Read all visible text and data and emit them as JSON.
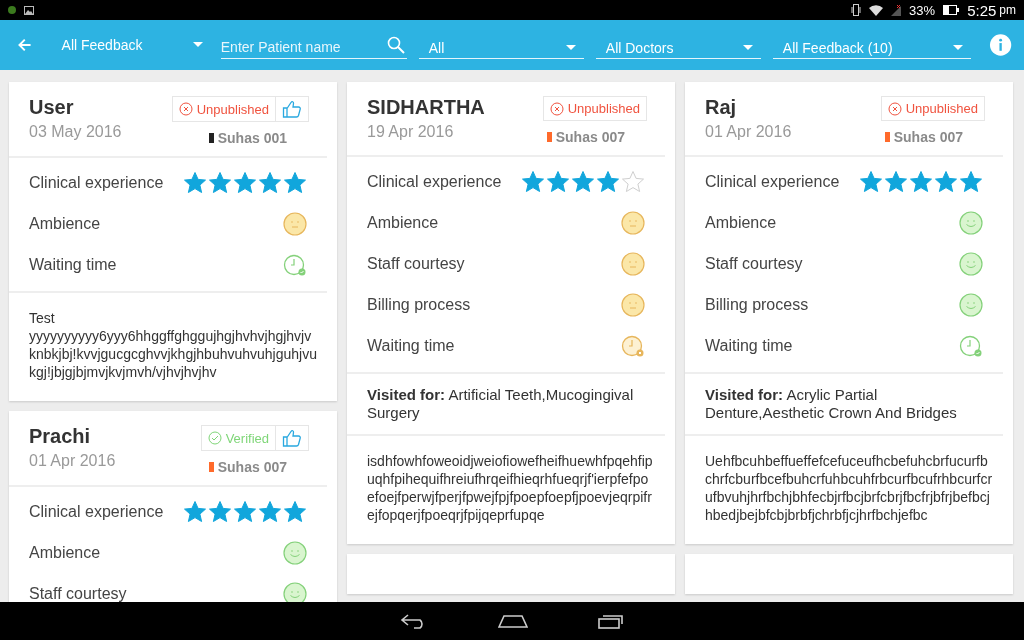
{
  "status_bar": {
    "battery": "33%",
    "time": "5:25",
    "ampm": "pm"
  },
  "app_bar": {
    "feedback_menu": "All Feedback",
    "search": {
      "placeholder": "Enter Patient name"
    },
    "filters": [
      {
        "label": "All"
      },
      {
        "label": "All Doctors"
      },
      {
        "label": "All Feedback (10)"
      }
    ]
  },
  "columns": [
    {
      "cards": [
        {
          "name": "User",
          "date": "03 May 2016",
          "status": {
            "kind": "unpublished",
            "label": "Unpublished"
          },
          "thumbs": true,
          "doctor": {
            "name": "Suhas 001",
            "color": "#222222"
          },
          "ratings": [
            {
              "label": "Clinical experience",
              "kind": "stars",
              "stars": 5
            },
            {
              "label": "Ambience",
              "kind": "face",
              "happy": false
            },
            {
              "label": "Waiting time",
              "kind": "clock",
              "happy": true
            }
          ],
          "comment": "Test yyyyyyyyyy6yyy6hhggffghggujhgjhvhvjhgjhvjvknbkjbj!kvvjgucgcghvvjkhgjhbuhvuhvuhjguhjvukgj!jbjgjbjmvjkvjmvh/vjhvjhvjhv"
        },
        {
          "name": "Prachi",
          "date": "01 Apr 2016",
          "status": {
            "kind": "verified",
            "label": "Verified"
          },
          "thumbs": true,
          "doctor": {
            "name": "Suhas 007",
            "color": "#ff6a2b"
          },
          "ratings": [
            {
              "label": "Clinical experience",
              "kind": "stars",
              "stars": 5
            },
            {
              "label": "Ambience",
              "kind": "face",
              "happy": true
            },
            {
              "label": "Staff courtesy",
              "kind": "face",
              "happy": true
            }
          ]
        }
      ]
    },
    {
      "cards": [
        {
          "name": "SIDHARTHA",
          "date": "19 Apr 2016",
          "status": {
            "kind": "unpublished",
            "label": "Unpublished"
          },
          "thumbs": false,
          "doctor": {
            "name": "Suhas 007",
            "color": "#ff6a2b"
          },
          "ratings": [
            {
              "label": "Clinical experience",
              "kind": "stars",
              "stars": 4
            },
            {
              "label": "Ambience",
              "kind": "face",
              "happy": false
            },
            {
              "label": "Staff courtesy",
              "kind": "face",
              "happy": false
            },
            {
              "label": "Billing process",
              "kind": "face",
              "happy": false
            },
            {
              "label": "Waiting time",
              "kind": "clock",
              "happy": false
            }
          ],
          "visited_for": "**Visited for:** Artificial Teeth,Mucogingival Surgery",
          "comment": "isdhfowhfoweoidjweiofiowefheifhuewhfpqehfipuqhfpihequifhreiufhrqeifhieqrhfueqrjf'ierpfefpoefoejfperwjfperjfpwejfpjfpoepfoepfjpoevjeqrpifrejfopqerjfpoeqrjfpijqeprfupqe"
        },
        {
          "kind": "cut"
        }
      ]
    },
    {
      "cards": [
        {
          "name": "Raj",
          "date": "01 Apr 2016",
          "status": {
            "kind": "unpublished",
            "label": "Unpublished"
          },
          "thumbs": false,
          "doctor": {
            "name": "Suhas 007",
            "color": "#ff6a2b"
          },
          "ratings": [
            {
              "label": "Clinical experience",
              "kind": "stars",
              "stars": 5
            },
            {
              "label": "Ambience",
              "kind": "face",
              "happy": true
            },
            {
              "label": "Staff courtesy",
              "kind": "face",
              "happy": true
            },
            {
              "label": "Billing process",
              "kind": "face",
              "happy": true
            },
            {
              "label": "Waiting time",
              "kind": "clock",
              "happy": true
            }
          ],
          "visited_for": "**Visited for:** Acrylic Partial Denture,Aesthetic Crown And Bridges",
          "comment": "Uehfbcuhbeffueffefcefuceufhcbefuhcbrfucurfbchrfcburfbcefbuhcrfuhbcuhfrbcurfbcufrhbcurfcrufbvuhjhrfbchjbhfecbjrfbcjbrfcbrjfbcfrjbfrjbefbcjhbedjbejbfcbjbrbfjchrbfjcjhrfbchjefbc"
        },
        {
          "kind": "cut"
        }
      ]
    }
  ]
}
